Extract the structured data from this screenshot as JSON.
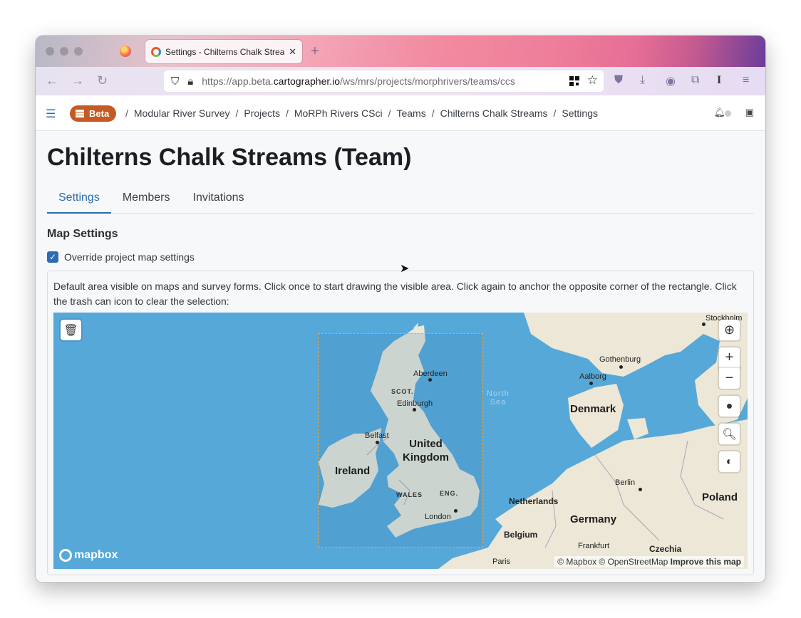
{
  "browser": {
    "tab_title": "Settings - Chilterns Chalk Streams",
    "tab_close": "✕",
    "new_tab": "+",
    "url_prefix": "https://app.beta.",
    "url_domain": "cartographer.io",
    "url_path": "/ws/mrs/projects/morphrivers/teams/ccs"
  },
  "header": {
    "badge": "Beta",
    "breadcrumbs": [
      "Modular River Survey",
      "Projects",
      "MoRPh Rivers CSci",
      "Teams",
      "Chilterns Chalk Streams",
      "Settings"
    ],
    "separator": "/"
  },
  "page": {
    "title": "Chilterns Chalk Streams (Team)",
    "tabs": [
      "Settings",
      "Members",
      "Invitations"
    ],
    "active_tab": "Settings",
    "section_title": "Map Settings",
    "checkbox_label": "Override project map settings",
    "checkbox_checked": true,
    "description": "Default area visible on maps and survey forms. Click once to start drawing the visible area. Click again to anchor the opposite corner of the rectangle. Click the trash can icon to clear the selection:"
  },
  "map": {
    "labels": {
      "stockholm": "Stockholm",
      "gothenburg": "Gothenburg",
      "aalborg": "Aalborg",
      "aberdeen": "Aberdeen",
      "scot": "SCOT.",
      "edinburgh": "Edinburgh",
      "north_sea": "North\nSea",
      "denmark": "Denmark",
      "belfast": "Belfast",
      "uk": "United\nKingdom",
      "ireland": "Ireland",
      "wales": "WALES",
      "eng": "ENG.",
      "london": "London",
      "netherlands": "Netherlands",
      "berlin": "Berlin",
      "poland": "Poland",
      "germany": "Germany",
      "belgium": "Belgium",
      "frankfurt": "Frankfurt",
      "czechia": "Czechia",
      "paris": "Paris"
    },
    "logo": "mapbox",
    "attribution_1": "© Mapbox © OpenStreetMap",
    "attribution_2": "Improve this map",
    "controls": [
      "trash-icon",
      "geolocate-icon",
      "zoom-in",
      "zoom-out",
      "marker-icon",
      "search-icon",
      "globe-icon"
    ],
    "zoom_in": "+",
    "zoom_out": "−"
  },
  "colors": {
    "water": "#56a8d9",
    "land": "#ece7d6",
    "accent": "#2f6bb0",
    "badge": "#c45a24",
    "selection": "#f0a73a"
  }
}
